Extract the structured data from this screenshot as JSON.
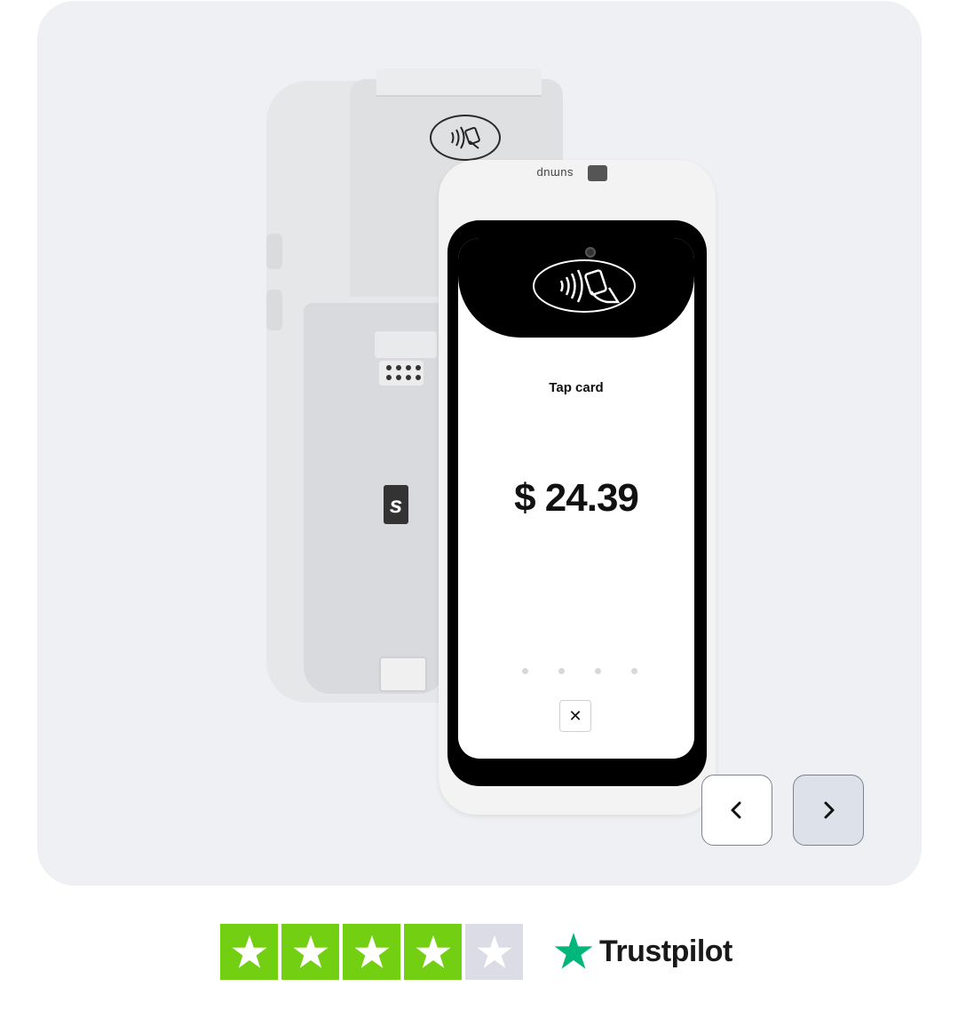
{
  "carousel": {
    "background_color": "#eff0f4",
    "product": {
      "front_brand": "sumup",
      "screen": {
        "prompt": "Tap card",
        "amount": "$ 24.39",
        "cancel_glyph": "✕"
      }
    },
    "nav": {
      "prev_glyph": "‹",
      "next_glyph": "›"
    }
  },
  "trustpilot": {
    "name": "Trustpilot",
    "rating_stars": 4,
    "max_stars": 5,
    "filled_color": "#73cf11",
    "empty_color": "#dcdce6",
    "logo_star_color": "#00b67a"
  }
}
